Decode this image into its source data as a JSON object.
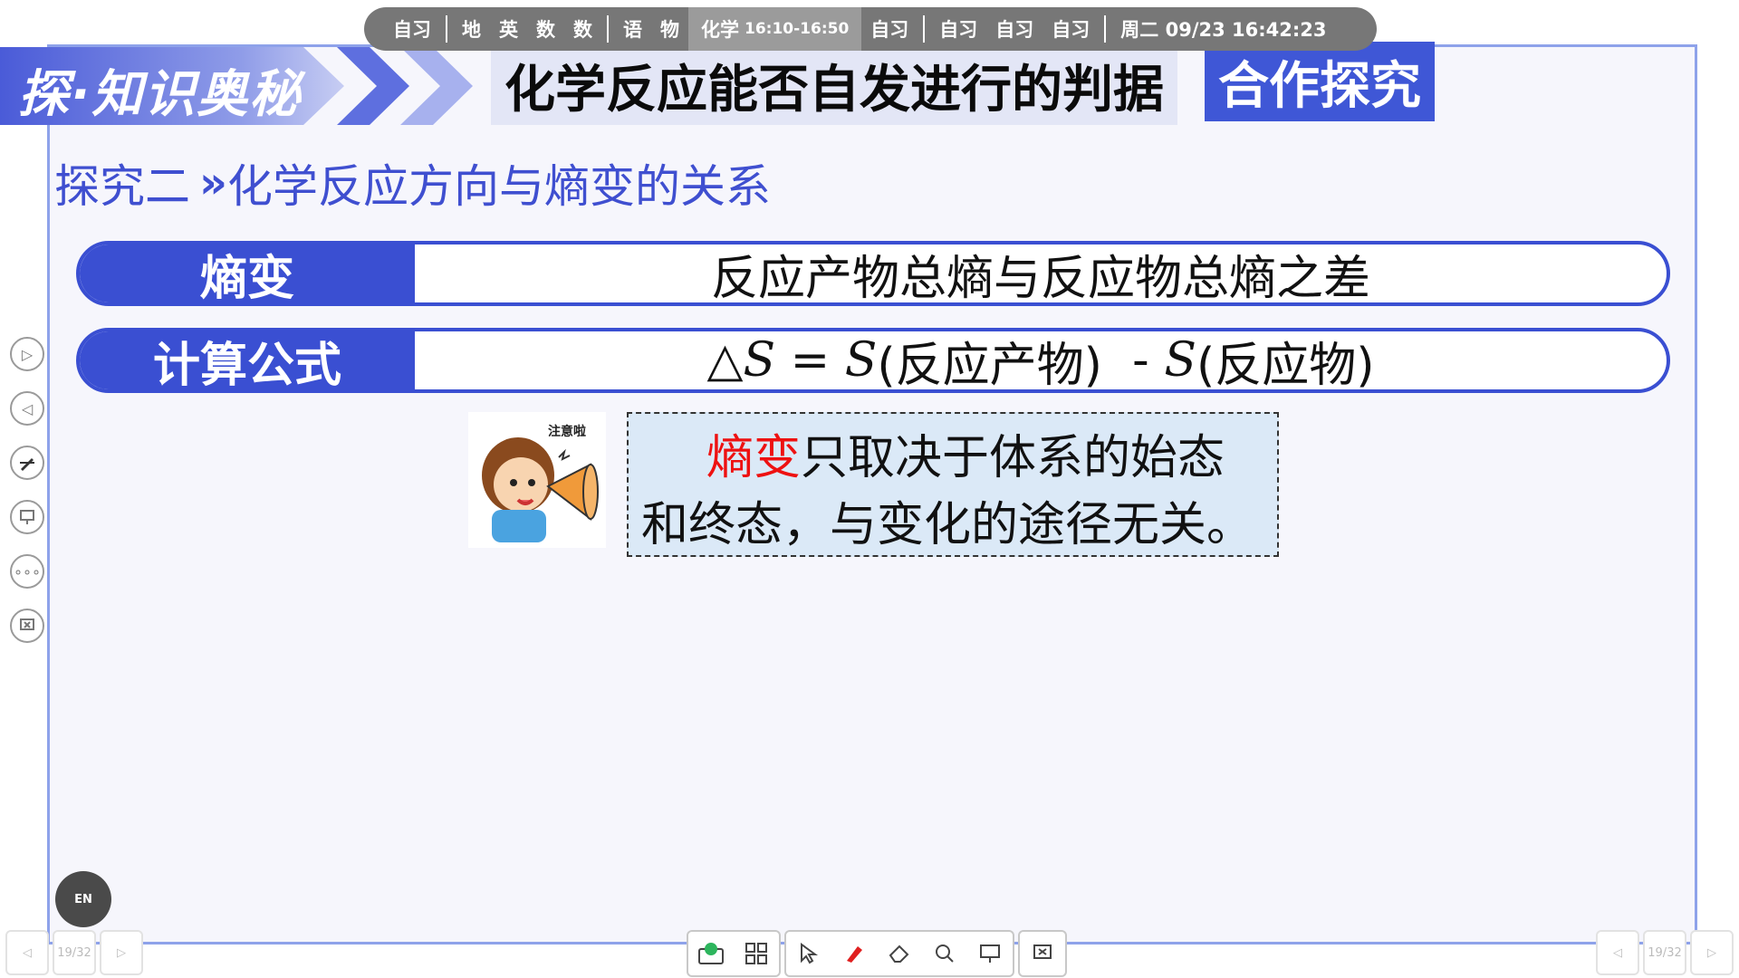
{
  "schedule": {
    "items": [
      "自习",
      "地",
      "英",
      "数",
      "数",
      "语",
      "物"
    ],
    "current_subject": "化学",
    "current_time": "16:10-16:50",
    "after": [
      "自习"
    ],
    "after2": [
      "自习",
      "自习",
      "自习"
    ],
    "datetime": "周二 09/23  16:42:23"
  },
  "header": {
    "brand": "探·知识奥秘",
    "title": "化学反应能否自发进行的判据",
    "badge": "合作探究"
  },
  "subtitle": {
    "prefix": "探究二",
    "arrow": "»",
    "text": "化学反应方向与熵变的关系"
  },
  "rows": [
    {
      "label": "熵变",
      "value": "反应产物总熵与反应物总熵之差"
    },
    {
      "label": "计算公式",
      "formula": {
        "delta": "△",
        "s1": "S",
        "eq": " = ",
        "s2": "S",
        "p1": "(反应产物)",
        "minus": "  - ",
        "s3": "S",
        "p2": "(反应物)"
      }
    }
  ],
  "note": {
    "highlight": "熵变",
    "line1_rest": "只取决于体系的始态",
    "line2": "和终态，与变化的途径无关。",
    "mascot_caption": "注意啦"
  },
  "left_tools": [
    "play-next-icon",
    "play-prev-icon",
    "pen-icon",
    "screen-icon",
    "more-icon",
    "exit-icon"
  ],
  "lang_button": "EN",
  "toolbar": [
    "sign-icon",
    "apps-icon",
    "cursor-icon",
    "marker-icon",
    "eraser-icon",
    "search-icon",
    "present-icon",
    "close-slide-icon"
  ],
  "pager": {
    "left": "19/32",
    "right": "19/32"
  },
  "colors": {
    "accent": "#3a4fd2",
    "highlight": "#e11111",
    "note_bg": "#dbe9f7"
  }
}
